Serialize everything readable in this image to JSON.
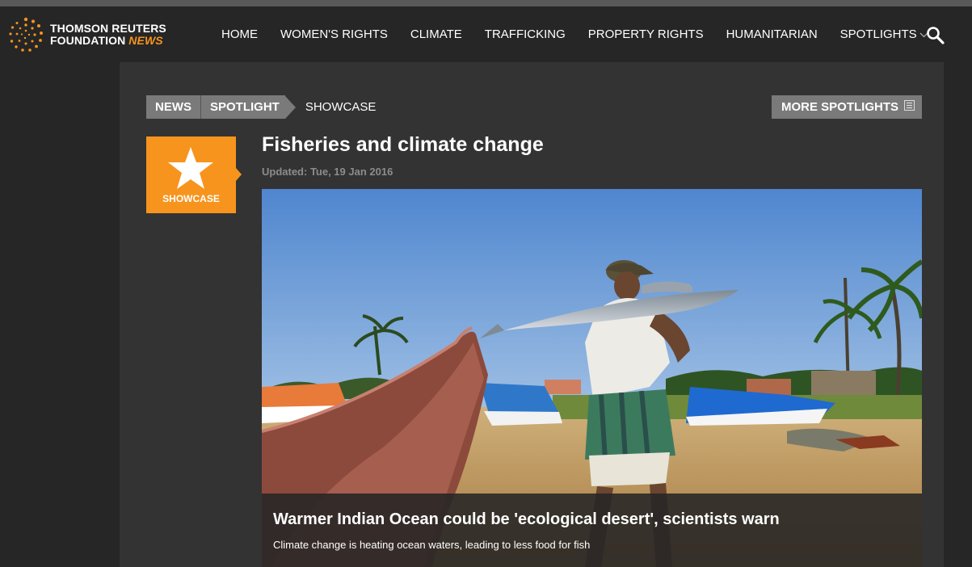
{
  "brand": {
    "line1": "THOMSON REUTERS",
    "line2": "FOUNDATION",
    "news": "NEWS",
    "accent_color": "#f7941d",
    "logo_icon": "dotted-spiral-logo"
  },
  "nav": {
    "items": [
      {
        "label": "HOME"
      },
      {
        "label": "WOMEN'S RIGHTS"
      },
      {
        "label": "CLIMATE"
      },
      {
        "label": "TRAFFICKING"
      },
      {
        "label": "PROPERTY RIGHTS"
      },
      {
        "label": "HUMANITARIAN"
      },
      {
        "label": "SPOTLIGHTS"
      }
    ],
    "spotlights_icon": "chevron-down-icon",
    "search_icon": "search-icon"
  },
  "breadcrumb": {
    "news": "NEWS",
    "spotlight": "SPOTLIGHT",
    "current": "SHOWCASE"
  },
  "more_spotlights": {
    "label": "MORE SPOTLIGHTS",
    "icon": "list-icon"
  },
  "badge": {
    "label": "SHOWCASE",
    "icon": "star-icon"
  },
  "article": {
    "title": "Fisheries and climate change",
    "updated": "Updated: Tue, 19 Jan 2016",
    "headline": "Warmer Indian Ocean could be 'ecological desert', scientists warn",
    "summary": "Climate change is heating ocean waters, leading to less food for fish"
  }
}
